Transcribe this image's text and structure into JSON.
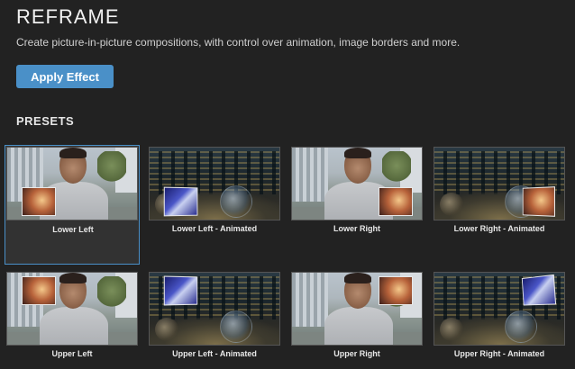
{
  "header": {
    "title": "REFRAME",
    "subtitle": "Create picture-in-picture compositions, with control over animation, image borders and more."
  },
  "actions": {
    "apply_label": "Apply Effect"
  },
  "presets": {
    "section_title": "PRESETS",
    "selected_index": 0,
    "items": [
      {
        "label": "Lower Left",
        "scene": "selfie",
        "pip": "lowerleft",
        "pip_style": "warm"
      },
      {
        "label": "Lower Left - Animated",
        "scene": "city",
        "pip": "lowerleft",
        "pip_style": "blue"
      },
      {
        "label": "Lower Right",
        "scene": "selfie",
        "pip": "lowerright",
        "pip_style": "warm"
      },
      {
        "label": "Lower Right - Animated",
        "scene": "city",
        "pip": "lowerright",
        "pip_style": "warm"
      },
      {
        "label": "Upper Left",
        "scene": "selfie",
        "pip": "upperleft",
        "pip_style": "warm"
      },
      {
        "label": "Upper Left - Animated",
        "scene": "city",
        "pip": "upperleft",
        "pip_style": "blue"
      },
      {
        "label": "Upper Right",
        "scene": "selfie",
        "pip": "upperright",
        "pip_style": "warm"
      },
      {
        "label": "Upper Right - Animated",
        "scene": "city",
        "pip": "upperright",
        "pip_style": "blue"
      }
    ]
  },
  "colors": {
    "background": "#222222",
    "accent": "#4a90c8",
    "selected_tile": "#323232"
  }
}
